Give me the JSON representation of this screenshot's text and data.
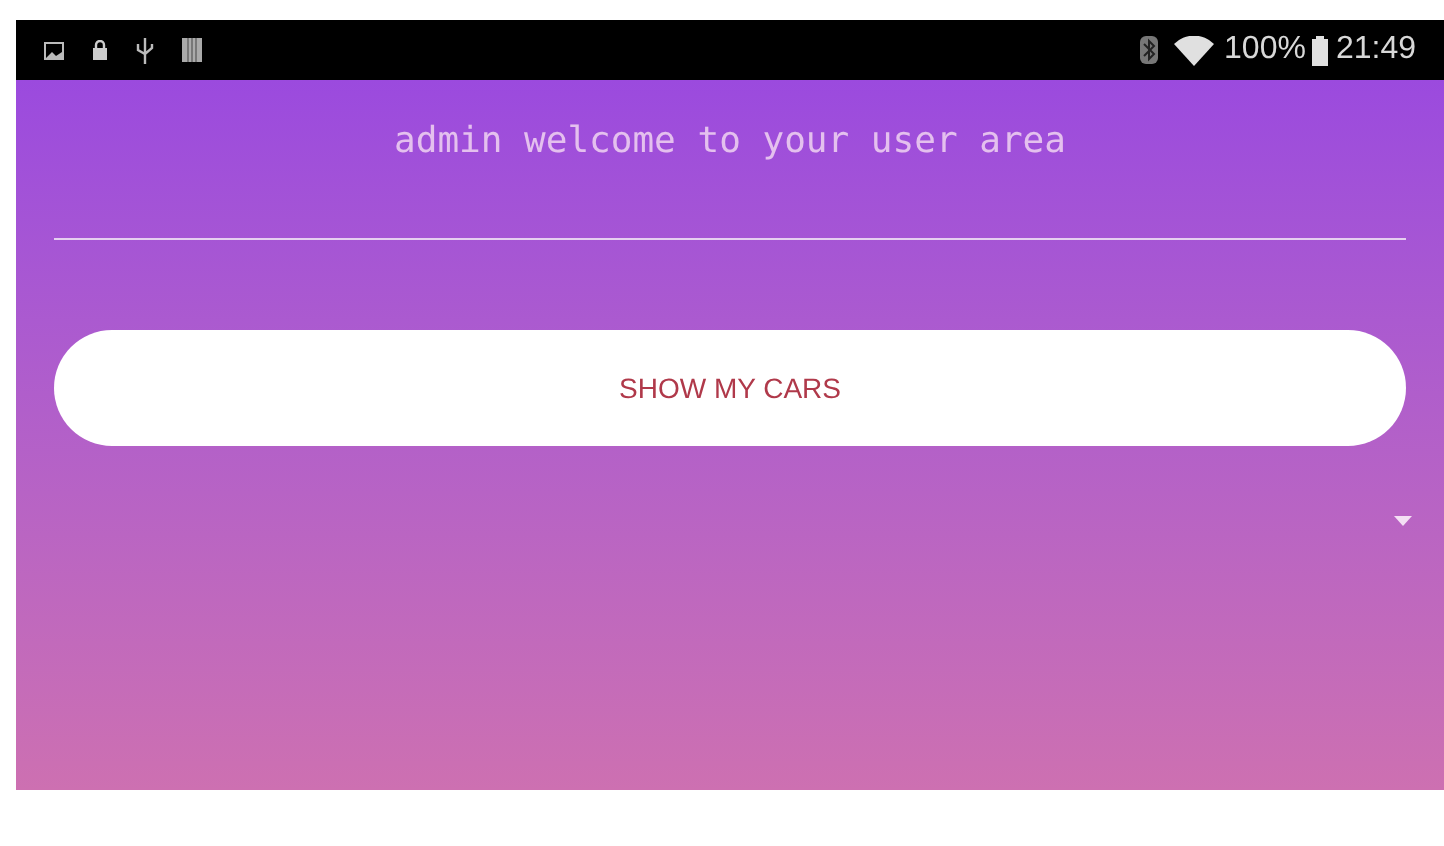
{
  "status_bar": {
    "battery_text": "100%",
    "time": "21:49"
  },
  "welcome_text": "admin welcome to your user area",
  "button": {
    "label": "SHOW MY CARS"
  }
}
